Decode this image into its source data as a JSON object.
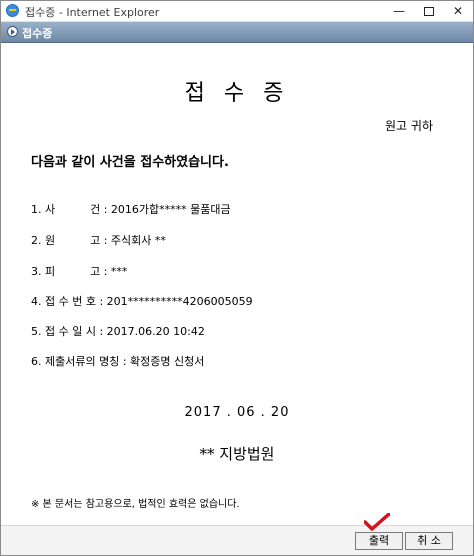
{
  "window": {
    "title": "접수증 - Internet Explorer",
    "minimize": "—",
    "close": "✕"
  },
  "header": {
    "title": "접수증"
  },
  "document": {
    "title": "접 수 증",
    "recipient": "원고 귀하",
    "intro": "다음과 같이 사건을 접수하였습니다.",
    "items": [
      {
        "label": "1. 사          건 :",
        "value": "2016가합***** 물품대금"
      },
      {
        "label": "2. 원          고 :",
        "value": "주식회사 **"
      },
      {
        "label": "3. 피          고 :",
        "value": "***"
      },
      {
        "label": "4. 접 수 번 호 :",
        "value": "201**********4206005059"
      },
      {
        "label": "5. 접 수 일 시 :",
        "value": "2017.06.20   10:42"
      },
      {
        "label": "6. 제출서류의 명칭 :",
        "value": "확정증명 신청서"
      }
    ],
    "date": "2017 . 06 . 20",
    "court": "** 지방법원",
    "note": "※ 본 문서는 참고용으로, 법적인 효력은 없습니다."
  },
  "footer": {
    "print_label": "출력",
    "cancel_label": "취 소"
  },
  "colors": {
    "header_bar": "#7a93b0",
    "check_mark": "#d4141c"
  }
}
